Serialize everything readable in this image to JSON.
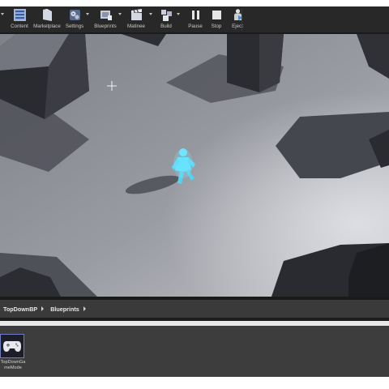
{
  "toolbar": {
    "buttons": [
      {
        "label": "Content",
        "icon": "content-browser-icon"
      },
      {
        "label": "Marketplace",
        "icon": "marketplace-icon"
      },
      {
        "label": "Settings",
        "icon": "settings-gears-icon"
      },
      {
        "label": "Blueprints",
        "icon": "blueprints-icon"
      },
      {
        "label": "Matinee",
        "icon": "matinee-clapper-icon"
      },
      {
        "label": "Build",
        "icon": "build-icon"
      },
      {
        "label": "Pause",
        "icon": "pause-icon"
      },
      {
        "label": "Stop",
        "icon": "stop-icon"
      },
      {
        "label": "Eject",
        "icon": "eject-icon"
      }
    ]
  },
  "content_browser": {
    "breadcrumb": [
      "TopDownBP",
      "Blueprints"
    ],
    "assets": [
      {
        "name": "TopDownGameMode",
        "icon": "gamepad-icon"
      }
    ]
  },
  "colors": {
    "character": "#5fe0ff",
    "floor": "#8f9198",
    "pillar_top": "#6e717a",
    "pillar_dark": "#26272b",
    "shadow": "#4a4c54",
    "toolbar_bg": "#282828",
    "asset_border": "#6d7ec4"
  }
}
